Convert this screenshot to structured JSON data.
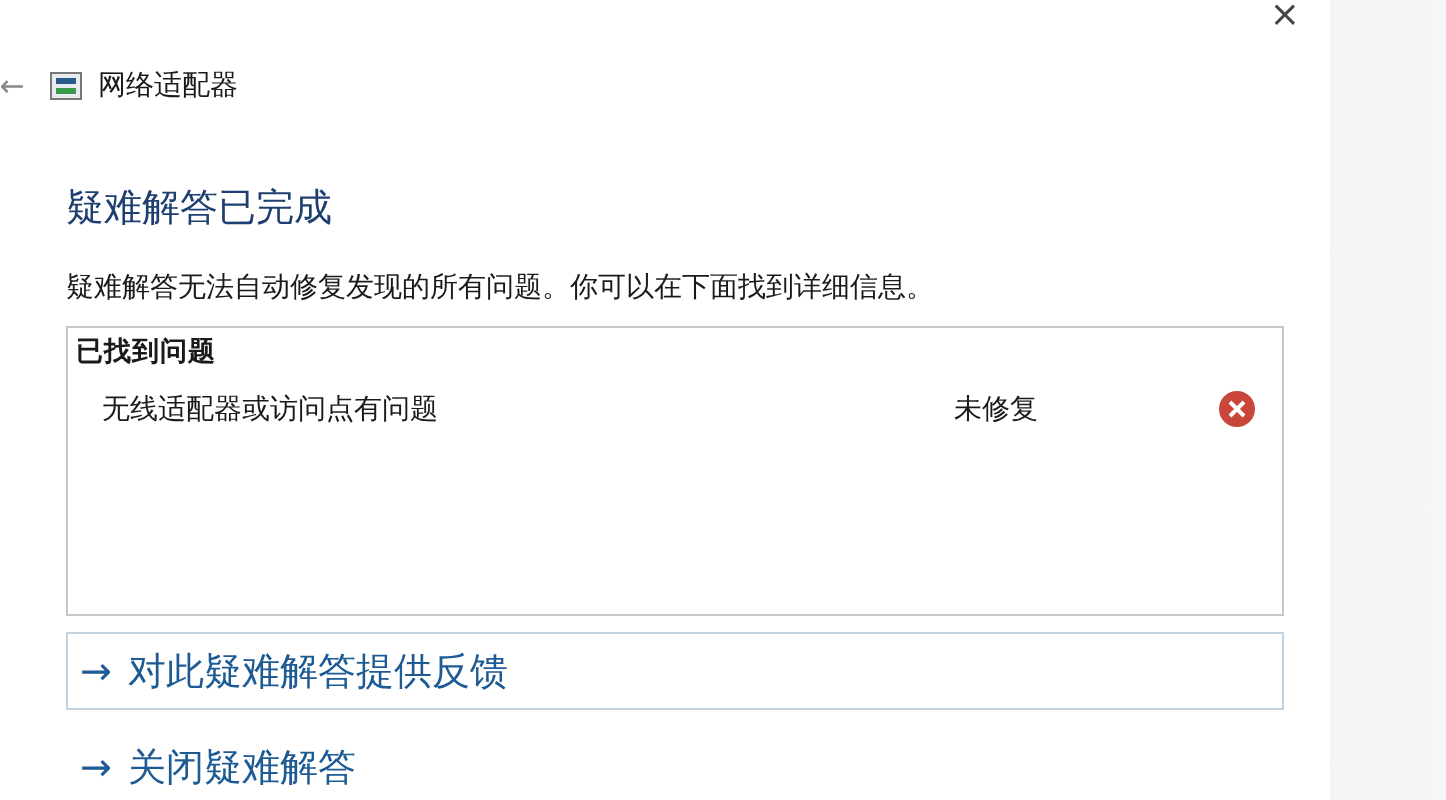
{
  "window": {
    "back": "←",
    "close": "×",
    "title": "网络适配器"
  },
  "heading": "疑难解答已完成",
  "description": "疑难解答无法自动修复发现的所有问题。你可以在下面找到详细信息。",
  "problems": {
    "header": "已找到问题",
    "rows": [
      {
        "name": "无线适配器或访问点有问题",
        "status": "未修复",
        "kind": "error"
      }
    ]
  },
  "links": [
    {
      "arrow": "→",
      "label": "对此疑难解答提供反馈",
      "boxed": true
    },
    {
      "arrow": "→",
      "label": "关闭疑难解答",
      "boxed": false
    }
  ]
}
